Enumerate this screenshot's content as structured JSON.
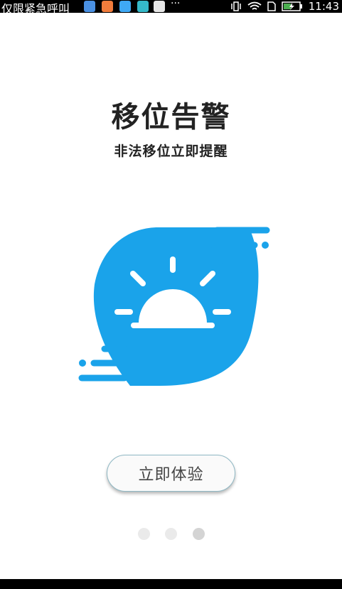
{
  "status_bar": {
    "carrier": "仅限紧急呼叫",
    "overflow": "···",
    "time": "11:43",
    "notifications": [
      {
        "icon": "location-app-icon",
        "color": "#4a90e2"
      },
      {
        "icon": "gallery-app-icon",
        "color": "#f07c3c"
      },
      {
        "icon": "china-app-icon",
        "color": "#3fa9f5"
      },
      {
        "icon": "mail-app-icon",
        "color": "#35b9c9"
      },
      {
        "icon": "font-app-icon",
        "color": "#e6e6e6"
      }
    ],
    "icons": [
      "vibrate-icon",
      "wifi-icon",
      "sim-icon",
      "battery-charging-icon"
    ]
  },
  "onboarding": {
    "title": "移位告警",
    "subtitle": "非法移位立即提醒",
    "illustration": "sunrise-cloud-icon",
    "accent_color": "#1aa3ea",
    "cta_label": "立即体验"
  },
  "pager": {
    "total": 3,
    "active_index": 2
  }
}
